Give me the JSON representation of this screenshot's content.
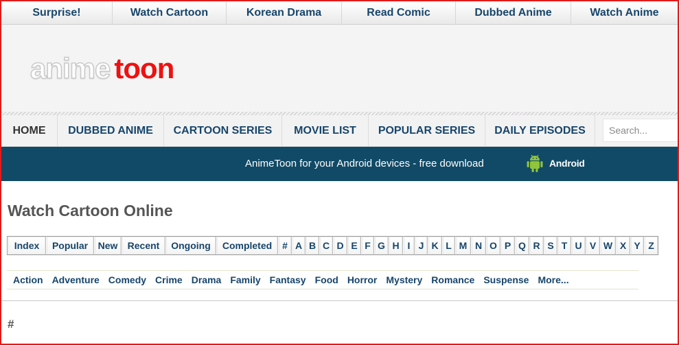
{
  "topbar": {
    "items": [
      {
        "label": "Surprise!"
      },
      {
        "label": "Watch Cartoon"
      },
      {
        "label": "Korean Drama"
      },
      {
        "label": "Read Comic"
      },
      {
        "label": "Dubbed Anime"
      },
      {
        "label": "Watch Anime"
      }
    ]
  },
  "logo": {
    "part1": "anime",
    "part2": "toon"
  },
  "mainnav": {
    "items": [
      {
        "label": "HOME"
      },
      {
        "label": "DUBBED ANIME"
      },
      {
        "label": "CARTOON SERIES"
      },
      {
        "label": "MOVIE LIST"
      },
      {
        "label": "POPULAR SERIES"
      },
      {
        "label": "DAILY EPISODES"
      }
    ],
    "search_placeholder": "Search..."
  },
  "promo": {
    "text": "AnimeToon for your Android devices - free download",
    "android_label": "Android",
    "icon": "android-icon"
  },
  "content": {
    "title": "Watch Cartoon Online",
    "alpha": [
      "Index",
      "Popular",
      "New",
      "Recent",
      "Ongoing",
      "Completed",
      "#",
      "A",
      "B",
      "C",
      "D",
      "E",
      "F",
      "G",
      "H",
      "I",
      "J",
      "K",
      "L",
      "M",
      "N",
      "O",
      "P",
      "Q",
      "R",
      "S",
      "T",
      "U",
      "V",
      "W",
      "X",
      "Y",
      "Z"
    ],
    "genres": [
      "Action",
      "Adventure",
      "Comedy",
      "Crime",
      "Drama",
      "Family",
      "Fantasy",
      "Food",
      "Horror",
      "Mystery",
      "Romance",
      "Suspense",
      "More..."
    ],
    "section_heading": "#"
  },
  "colors": {
    "link": "#17456b",
    "promo_bg": "#114a66",
    "logo_accent": "#ee1111",
    "frame": "#e01b1b"
  }
}
